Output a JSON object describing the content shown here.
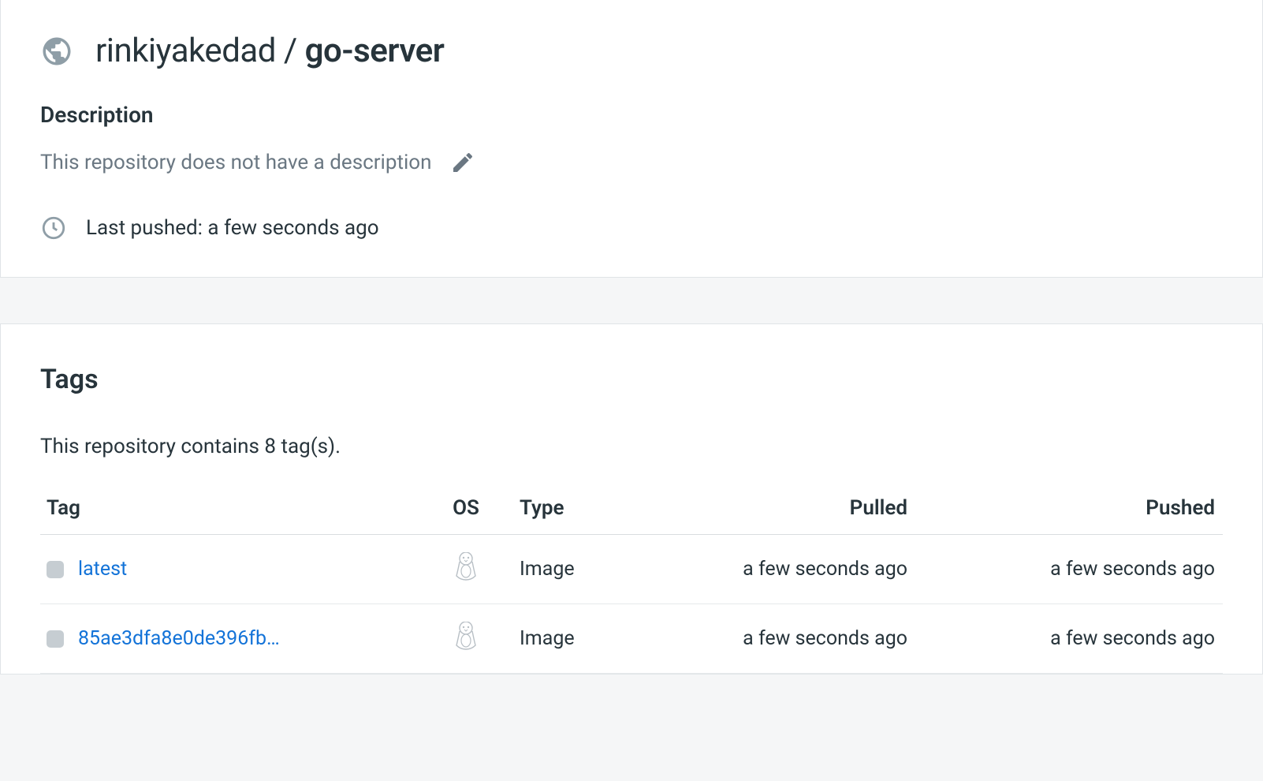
{
  "header": {
    "owner": "rinkiyakedad",
    "separator": " / ",
    "repo": "go-server",
    "description_heading": "Description",
    "description_text": "This repository does not have a description",
    "last_pushed_label": "Last pushed: a few seconds ago"
  },
  "tags": {
    "heading": "Tags",
    "count_text": "This repository contains 8 tag(s).",
    "columns": {
      "tag": "Tag",
      "os": "OS",
      "type": "Type",
      "pulled": "Pulled",
      "pushed": "Pushed"
    },
    "rows": [
      {
        "name": "latest",
        "os": "linux",
        "type": "Image",
        "pulled": "a few seconds ago",
        "pushed": "a few seconds ago"
      },
      {
        "name": "85ae3dfa8e0de396fb…",
        "os": "linux",
        "type": "Image",
        "pulled": "a few seconds ago",
        "pushed": "a few seconds ago"
      }
    ]
  }
}
